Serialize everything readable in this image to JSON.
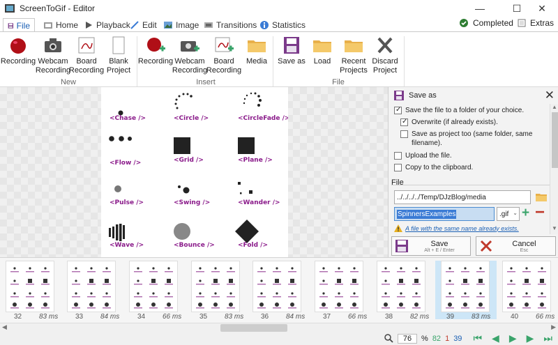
{
  "window": {
    "title": "ScreenToGif - Editor",
    "minimize": "—",
    "maximize": "☐",
    "close": "✕"
  },
  "tabs": [
    {
      "label": "File",
      "icon": "save-icon"
    },
    {
      "label": "Home",
      "icon": "home-icon"
    },
    {
      "label": "Playback",
      "icon": "play-icon"
    },
    {
      "label": "Edit",
      "icon": "pencil-icon"
    },
    {
      "label": "Image",
      "icon": "image-icon"
    },
    {
      "label": "Transitions",
      "icon": "transitions-icon"
    },
    {
      "label": "Statistics",
      "icon": "info-icon"
    }
  ],
  "status": {
    "completed": "Completed",
    "extras": "Extras"
  },
  "ribbon": {
    "new_group": "New",
    "insert_group": "Insert",
    "file_group": "File",
    "new": [
      "Recording",
      "Webcam Recording",
      "Board Recording",
      "Blank Project"
    ],
    "insert": [
      "Recording",
      "Webcam Recording",
      "Board Recording",
      "Media"
    ],
    "file": [
      "Save as",
      "Load",
      "Recent Projects",
      "Discard Project"
    ]
  },
  "spinners": [
    "<Chase />",
    "<Circle />",
    "<CircleFade />",
    "<Flow />",
    "<Grid />",
    "<Plane />",
    "<Pulse />",
    "<Swing />",
    "<Wander />",
    "<Wave />",
    "<Bounce />",
    "<Fold />"
  ],
  "panel": {
    "title": "Save as",
    "save_to_folder": "Save the file to a folder of your choice.",
    "overwrite": "Overwrite (if already exists).",
    "save_project": "Save as project too (same folder, same filename).",
    "upload": "Upload the file.",
    "copy_clipboard": "Copy to the clipboard.",
    "file_section": "File",
    "folder_path": "../../../../Temp/DJzBlog/media",
    "filename": "SpinnersExamples",
    "extension": ".gif",
    "warning": "A file with the same name already exists.",
    "save_label": "Save",
    "save_shortcut": "Alt + E / Enter",
    "cancel_label": "Cancel",
    "cancel_shortcut": "Esc"
  },
  "frames": [
    {
      "num": "32",
      "ms": "83 ms"
    },
    {
      "num": "33",
      "ms": "84 ms"
    },
    {
      "num": "34",
      "ms": "66 ms"
    },
    {
      "num": "35",
      "ms": "83 ms"
    },
    {
      "num": "36",
      "ms": "84 ms"
    },
    {
      "num": "37",
      "ms": "66 ms"
    },
    {
      "num": "38",
      "ms": "82 ms"
    },
    {
      "num": "39",
      "ms": "83 ms"
    },
    {
      "num": "40",
      "ms": "66 ms"
    }
  ],
  "statusbar": {
    "zoom": "76",
    "percent": "%",
    "total_frames": "82",
    "selected": "1",
    "current": "39"
  },
  "colors": {
    "accent": "#1a5fb4",
    "spinner_label": "#8a1a8a",
    "green": "#3aa46b",
    "red": "#c0392b"
  }
}
